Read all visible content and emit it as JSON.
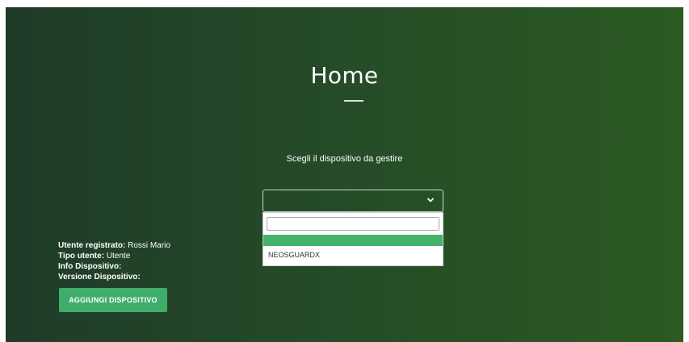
{
  "page": {
    "title": "Home",
    "prompt": "Scegli il dispositivo da gestire"
  },
  "device_select": {
    "selected_value": "",
    "search_value": "",
    "options": [
      "",
      "NEOSGUARDX"
    ],
    "highlight_color": "#45b26b",
    "chevron_icon": "chevron-down-icon"
  },
  "user_info": {
    "registered_user_label": "Utente registrato:",
    "registered_user_value": "Rossi Mario",
    "user_type_label": "Tipo utente:",
    "user_type_value": "Utente",
    "device_info_label": "Info Dispositivo:",
    "device_info_value": "",
    "device_version_label": "Versione Dispositivo:",
    "device_version_value": ""
  },
  "actions": {
    "add_device_label": "AGGIUNGI DISPOSITIVO"
  },
  "colors": {
    "background_start": "#1f3b28",
    "background_end": "#2b5a22",
    "button": "#3fae6a"
  }
}
